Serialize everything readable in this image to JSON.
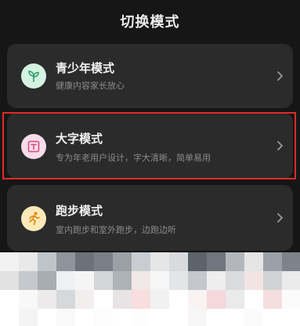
{
  "header": {
    "title": "切换模式"
  },
  "modes": [
    {
      "name": "青少年模式",
      "desc": "健康内容家长放心",
      "icon": "sprout-icon"
    },
    {
      "name": "大字模式",
      "desc": "专为年老用户设计，字大清晰，简单易用",
      "icon": "text-box-icon"
    },
    {
      "name": "跑步模式",
      "desc": "室内跑步和室外跑步，边跑边听",
      "icon": "runner-icon"
    }
  ],
  "colors": {
    "background": "#161616",
    "card": "#2b2b2b",
    "highlight": "#e02b2b",
    "teen_icon_bg": "#d5f2e3",
    "big_icon_bg": "#f7dcea",
    "run_icon_bg": "#fbe9b8"
  },
  "mosaic": {
    "colors": [
      "#f2f2f2",
      "#e9e9e9",
      "#bfc4c8",
      "#8e949b",
      "#6c7279",
      "#7a8087",
      "#9aa0a6",
      "#c9cdd1",
      "#e6e6e6",
      "#d8dadd",
      "#5d636b",
      "#70767d",
      "#b3b7bc",
      "#e5e5e5",
      "#9ba1a8",
      "#7d838a",
      "#e2e2e2",
      "#c5c8cc",
      "#a8adb2",
      "#eef0f1",
      "#f5f5f5",
      "#d3d6d9",
      "#aeb3b8",
      "#f0e9e7",
      "#f6f6f6",
      "#e3e5e7",
      "#c4c8cc",
      "#eeeeee",
      "#d9dbdd",
      "#f3e4e4",
      "#d0d3d6",
      "#ebebeb",
      "#ffffff",
      "#f8f8f8",
      "#eceaea",
      "#d6d8da",
      "#f2eeee",
      "#ffffff",
      "#e8e4e6",
      "#f8dede",
      "#f1f1f1",
      "#ffffff",
      "#f9f3f3",
      "#f4d8dc",
      "#eaeaea",
      "#ffffff",
      "#f5dede",
      "#fbfbfb",
      "#ffffff",
      "#f4f4f4",
      "#ffffff",
      "#f9f9f9",
      "#ffffff",
      "#fcfcfc",
      "#ffffff",
      "#fdfdfd",
      "#ffffff",
      "#ffffff",
      "#f7f7f7",
      "#ffffff",
      "#ffffff",
      "#fbfbfb",
      "#ffffff",
      "#ffffff"
    ]
  }
}
